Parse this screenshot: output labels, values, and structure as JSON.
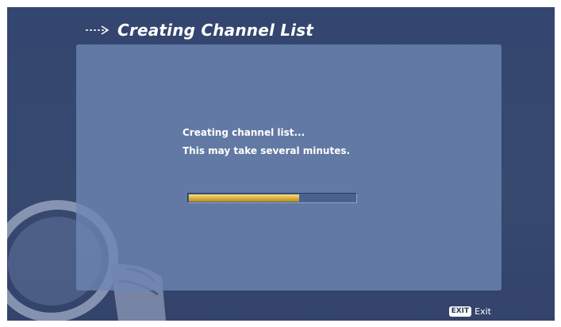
{
  "header": {
    "title": "Creating Channel List",
    "arrow_icon": "right-arrow-icon"
  },
  "dialog": {
    "line1": "Creating channel list...",
    "line2": "This may take several minutes."
  },
  "progress": {
    "fraction": 0.66
  },
  "footer": {
    "exit_key": "EXIT",
    "exit_label": "Exit"
  },
  "colors": {
    "background": "#36486f",
    "panel": "#6e86b4",
    "progress_fill": "#e0b63e"
  }
}
